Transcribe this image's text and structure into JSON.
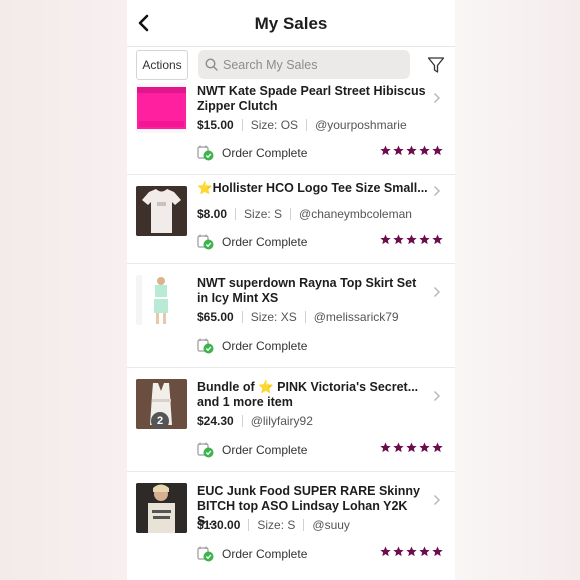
{
  "header": {
    "title": "My Sales"
  },
  "toolbar": {
    "actions_label": "Actions",
    "search_placeholder": "Search My Sales"
  },
  "colors": {
    "star": "#6d0d4d",
    "check": "#3bb44a",
    "clutch": "#ff1f9a"
  },
  "items": [
    {
      "title": "NWT Kate Spade Pearl Street Hibiscus Zipper Clutch",
      "price": "$15.00",
      "size": "Size: OS",
      "buyer": "@yourposhmarie",
      "status": "Order Complete",
      "rating": 5
    },
    {
      "title": "⭐️Hollister HCO Logo Tee Size Small...",
      "price": "$8.00",
      "size": "Size: S",
      "buyer": "@chaneymbcoleman",
      "status": "Order Complete",
      "rating": 5
    },
    {
      "title": "NWT superdown Rayna Top Skirt Set in Icy Mint XS",
      "price": "$65.00",
      "size": "Size: XS",
      "buyer": "@melissarick79",
      "status": "Order Complete",
      "rating": 0
    },
    {
      "title": "Bundle of ⭐️ PINK Victoria's Secret...",
      "subtitle": "and 1 more item",
      "price": "$24.30",
      "buyer": "@lilyfairy92",
      "status": "Order Complete",
      "rating": 5,
      "badge": "2"
    },
    {
      "title": "EUC Junk Food SUPER RARE Skinny BITCH top ASO Lindsay Lohan Y2K S...",
      "price": "$130.00",
      "size": "Size: S",
      "buyer": "@suuy",
      "status": "Order Complete",
      "rating": 5
    }
  ]
}
